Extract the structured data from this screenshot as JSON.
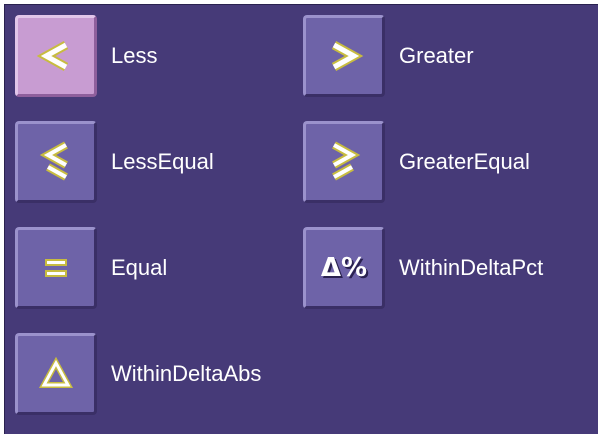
{
  "options": [
    {
      "key": "less",
      "label": "Less",
      "icon": "less-than-icon",
      "selected": true
    },
    {
      "key": "greater",
      "label": "Greater",
      "icon": "greater-than-icon",
      "selected": false
    },
    {
      "key": "less_equal",
      "label": "LessEqual",
      "icon": "less-equal-icon",
      "selected": false
    },
    {
      "key": "greater_equal",
      "label": "GreaterEqual",
      "icon": "greater-equal-icon",
      "selected": false
    },
    {
      "key": "equal",
      "label": "Equal",
      "icon": "equal-icon",
      "selected": false
    },
    {
      "key": "within_delta_pct",
      "label": "WithinDeltaPct",
      "icon": "delta-percent-icon",
      "icon_text": "Δ%",
      "selected": false
    },
    {
      "key": "within_delta_abs",
      "label": "WithinDeltaAbs",
      "icon": "delta-icon",
      "selected": false
    }
  ],
  "colors": {
    "panel_bg": "#463a78",
    "button_bg": "#6e63a8",
    "button_selected_bg": "#c89cd2",
    "glyph_fill": "#ffffff",
    "glyph_outline": "#c8bc40",
    "label_text": "#ffffff"
  }
}
